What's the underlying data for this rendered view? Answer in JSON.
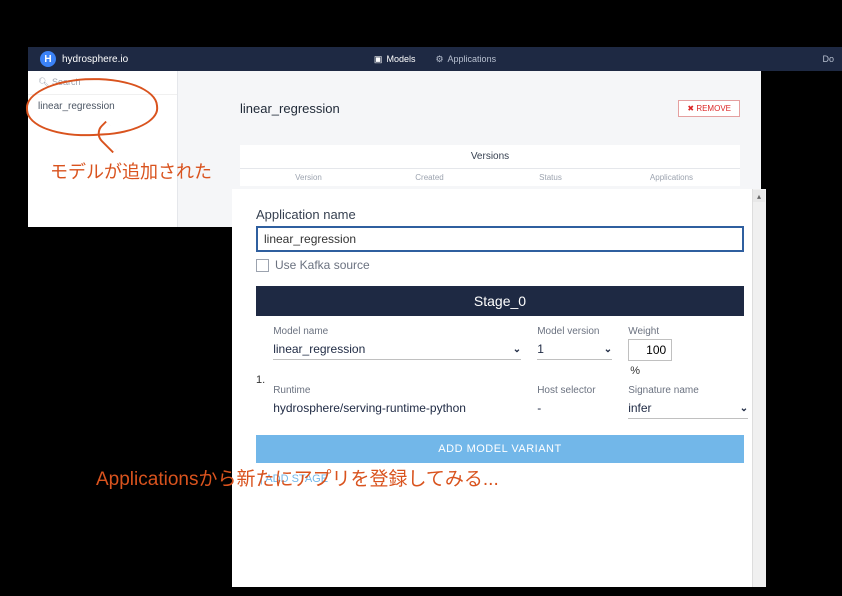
{
  "topbar": {
    "brand": "hydrosphere.io",
    "brand_letter": "H",
    "nav_models": "Models",
    "nav_apps": "Applications",
    "nav_right": "Do"
  },
  "sidebar": {
    "search_placeholder": "Search",
    "item1": "linear_regression"
  },
  "main": {
    "title": "linear_regression",
    "remove": "✖ REMOVE"
  },
  "versions": {
    "title": "Versions",
    "h_version": "Version",
    "h_created": "Created",
    "h_status": "Status",
    "h_apps": "Applications"
  },
  "annotations": {
    "a1": "モデルが追加された",
    "a2": "Applicationsから新たにアプリを登録してみる..."
  },
  "dialog": {
    "app_name_label": "Application name",
    "app_name_value": "linear_regression",
    "kafka_label": "Use Kafka source",
    "stage_title": "Stage_0",
    "row_num": "1.",
    "model_name_label": "Model name",
    "model_name_value": "linear_regression",
    "model_version_label": "Model version",
    "model_version_value": "1",
    "weight_label": "Weight",
    "weight_value": "100",
    "weight_pct": "%",
    "runtime_label": "Runtime",
    "runtime_value": "hydrosphere/serving-runtime-python",
    "host_label": "Host selector",
    "host_value": "-",
    "sig_label": "Signature name",
    "sig_value": "infer",
    "add_variant": "ADD MODEL VARIANT",
    "add_stage": "| ADD STAGE"
  }
}
